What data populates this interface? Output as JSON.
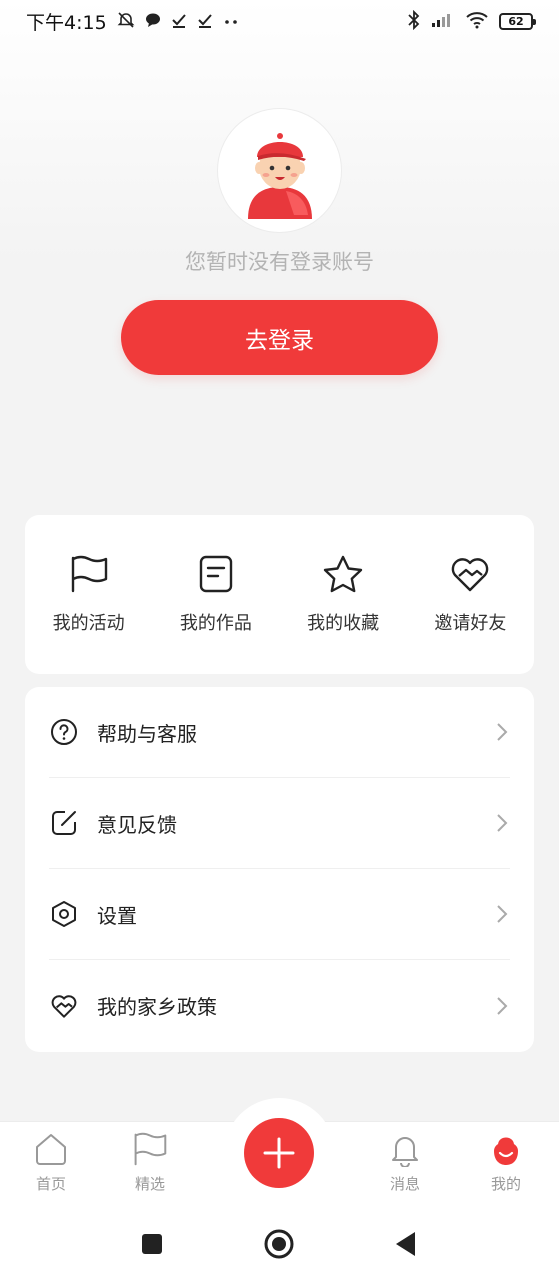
{
  "status_bar": {
    "time": "下午4:15",
    "battery": "62",
    "icons": [
      "mute-icon",
      "chat-bubble-icon",
      "check-icon",
      "check-icon",
      "more-dots-icon",
      "bluetooth-icon",
      "signal-icon",
      "wifi-icon",
      "battery-icon"
    ]
  },
  "profile": {
    "avatar_icon": "user-avatar-icon",
    "login_hint": "您暂时没有登录账号",
    "login_button": "去登录"
  },
  "quick_actions": [
    {
      "label": "我的活动",
      "icon": "flag-icon"
    },
    {
      "label": "我的作品",
      "icon": "document-icon"
    },
    {
      "label": "我的收藏",
      "icon": "star-icon"
    },
    {
      "label": "邀请好友",
      "icon": "heart-handshake-icon"
    }
  ],
  "menu": [
    {
      "label": "帮助与客服",
      "icon": "help-circle-icon"
    },
    {
      "label": "意见反馈",
      "icon": "edit-icon"
    },
    {
      "label": "设置",
      "icon": "settings-hexagon-icon"
    },
    {
      "label": "我的家乡政策",
      "icon": "heart-handshake-icon"
    }
  ],
  "tab_bar": {
    "items": [
      {
        "label": "首页",
        "icon": "home-icon"
      },
      {
        "label": "精选",
        "icon": "flag-icon"
      },
      {
        "label": "消息",
        "icon": "bell-icon"
      },
      {
        "label": "我的",
        "icon": "profile-icon"
      }
    ],
    "center_icon": "plus-icon"
  },
  "colors": {
    "accent": "#f03a3a",
    "hint_text": "#b3b3b3",
    "background": "#f3f3f3"
  }
}
